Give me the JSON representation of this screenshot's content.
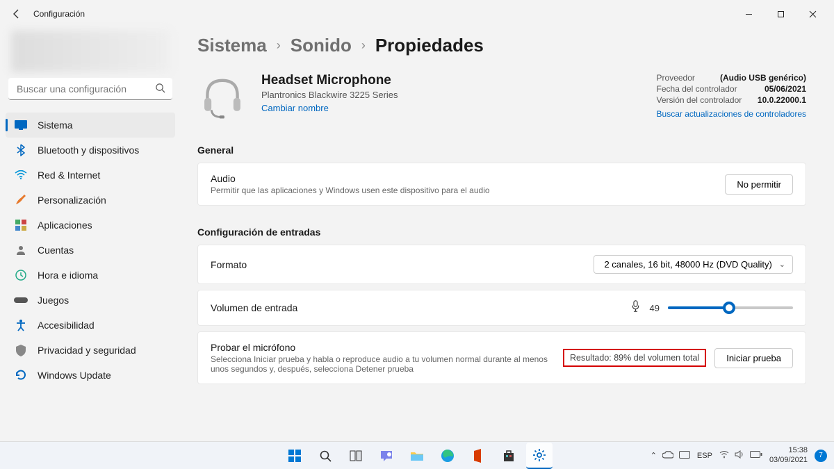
{
  "window": {
    "title": "Configuración"
  },
  "search": {
    "placeholder": "Buscar una configuración"
  },
  "sidebar": {
    "items": [
      {
        "label": "Sistema",
        "icon": "💻",
        "color": "#0067c0"
      },
      {
        "label": "Bluetooth y dispositivos",
        "icon": "bt",
        "color": "#0067c0"
      },
      {
        "label": "Red & Internet",
        "icon": "wifi",
        "color": "#0067c0"
      },
      {
        "label": "Personalización",
        "icon": "brush",
        "color": "#e77a2d"
      },
      {
        "label": "Aplicaciones",
        "icon": "apps",
        "color": "#5b5b9f"
      },
      {
        "label": "Cuentas",
        "icon": "user",
        "color": "#6e6e6e"
      },
      {
        "label": "Hora e idioma",
        "icon": "clock",
        "color": "#2a8"
      },
      {
        "label": "Juegos",
        "icon": "game",
        "color": "#555"
      },
      {
        "label": "Accesibilidad",
        "icon": "access",
        "color": "#0067c0"
      },
      {
        "label": "Privacidad y seguridad",
        "icon": "shield",
        "color": "#777"
      },
      {
        "label": "Windows Update",
        "icon": "update",
        "color": "#0067c0"
      }
    ]
  },
  "breadcrumb": {
    "a": "Sistema",
    "b": "Sonido",
    "c": "Propiedades"
  },
  "device": {
    "name": "Headset Microphone",
    "sub": "Plantronics Blackwire 3225 Series",
    "rename": "Cambiar nombre"
  },
  "driver": {
    "provider_label": "Proveedor",
    "provider_value": "(Audio USB genérico)",
    "date_label": "Fecha del controlador",
    "date_value": "05/06/2021",
    "version_label": "Versión del controlador",
    "version_value": "10.0.22000.1",
    "check_link": "Buscar actualizaciones de controladores"
  },
  "sections": {
    "general": "General",
    "audio_title": "Audio",
    "audio_desc": "Permitir que las aplicaciones y Windows usen este dispositivo para el audio",
    "disallow": "No permitir",
    "input_config": "Configuración de entradas",
    "format": "Formato",
    "format_value": "2 canales, 16 bit, 48000 Hz (DVD Quality)",
    "input_volume": "Volumen de entrada",
    "volume_value": "49",
    "test_title": "Probar el micrófono",
    "test_desc": "Selecciona Iniciar prueba y habla o reproduce audio a tu volumen normal durante al menos unos segundos y, después, selecciona Detener prueba",
    "test_result": "Resultado: 89% del volumen total",
    "start_test": "Iniciar prueba"
  },
  "taskbar": {
    "lang": "ESP",
    "time": "15:38",
    "date": "03/09/2021",
    "badge": "7"
  }
}
